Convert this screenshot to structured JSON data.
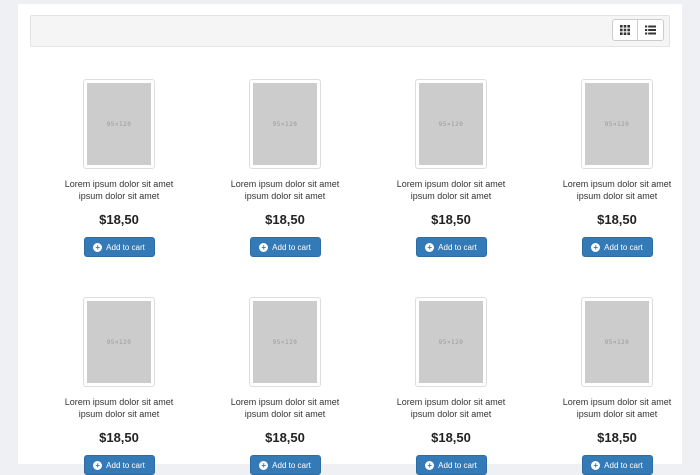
{
  "toolbar": {
    "grid_icon": "grid-icon",
    "list_icon": "list-icon"
  },
  "colors": {
    "accent": "#337ab7",
    "toolbar_bg": "#f5f5f5",
    "page_bg": "#eef0f4"
  },
  "products": [
    {
      "thumb_text": "95×120",
      "name_line1": "Lorem ipsum dolor sit amet",
      "name_line2": "ipsum dolor sit amet",
      "price": "$18,50",
      "button": "Add to cart"
    },
    {
      "thumb_text": "95×120",
      "name_line1": "Lorem ipsum dolor sit amet",
      "name_line2": "ipsum dolor sit amet",
      "price": "$18,50",
      "button": "Add to cart"
    },
    {
      "thumb_text": "95×120",
      "name_line1": "Lorem ipsum dolor sit amet",
      "name_line2": "ipsum dolor sit amet",
      "price": "$18,50",
      "button": "Add to cart"
    },
    {
      "thumb_text": "95×120",
      "name_line1": "Lorem ipsum dolor sit amet",
      "name_line2": "ipsum dolor sit amet",
      "price": "$18,50",
      "button": "Add to cart"
    },
    {
      "thumb_text": "95×120",
      "name_line1": "Lorem ipsum dolor sit amet",
      "name_line2": "ipsum dolor sit amet",
      "price": "$18,50",
      "button": "Add to cart"
    },
    {
      "thumb_text": "95×120",
      "name_line1": "Lorem ipsum dolor sit amet",
      "name_line2": "ipsum dolor sit amet",
      "price": "$18,50",
      "button": "Add to cart"
    },
    {
      "thumb_text": "95×120",
      "name_line1": "Lorem ipsum dolor sit amet",
      "name_line2": "ipsum dolor sit amet",
      "price": "$18,50",
      "button": "Add to cart"
    },
    {
      "thumb_text": "95×120",
      "name_line1": "Lorem ipsum dolor sit amet",
      "name_line2": "ipsum dolor sit amet",
      "price": "$18,50",
      "button": "Add to cart"
    }
  ]
}
